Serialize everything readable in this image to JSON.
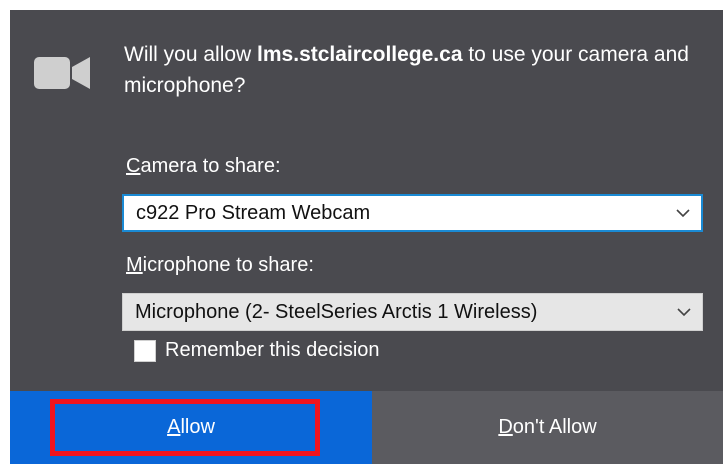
{
  "prompt": {
    "message_prefix": "Will you allow ",
    "host": "lms.stclaircollege.ca",
    "message_suffix": " to use your camera and microphone?"
  },
  "camera": {
    "label_accesskey": "C",
    "label_rest": "amera to share:",
    "selected": "c922 Pro Stream Webcam",
    "icon": "chevron-down-icon"
  },
  "microphone": {
    "label_accesskey": "M",
    "label_rest": "icrophone to share:",
    "selected": "Microphone (2- SteelSeries Arctis 1 Wireless)",
    "icon": "chevron-down-icon"
  },
  "remember": {
    "label": "Remember this decision",
    "checked": false
  },
  "buttons": {
    "allow_accesskey": "A",
    "allow_rest": "llow",
    "deny_accesskey": "D",
    "deny_rest": "on't Allow"
  },
  "icons": {
    "device": "camera-icon"
  },
  "colors": {
    "panel": "#4a4a4f",
    "allow": "#0a67d8",
    "deny": "#5b5b60",
    "highlight": "#f0141e",
    "focus_border": "#1a8ad4"
  }
}
